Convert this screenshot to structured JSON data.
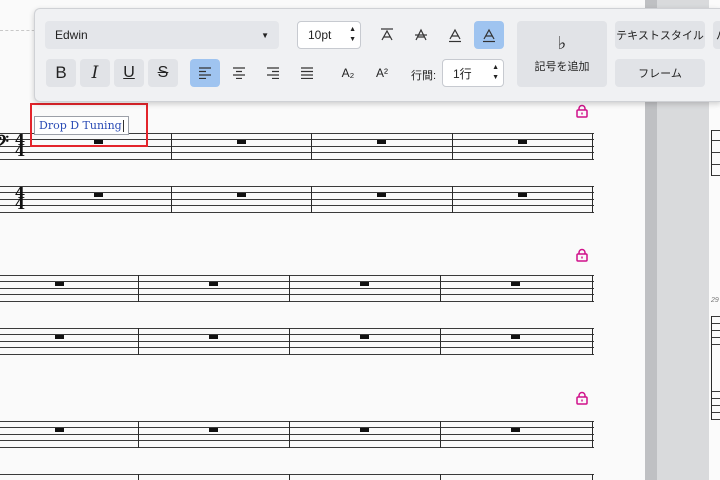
{
  "toolbar": {
    "font_name": "Edwin",
    "font_size": "10pt",
    "line_spacing_label": "行間:",
    "line_spacing_value": "1行",
    "add_symbol_label": "記号を追加",
    "add_symbol_glyph": "♭",
    "text_style_label": "テキストスタイル",
    "frame_label": "フレーム",
    "edge_label": "パ",
    "bold_label": "B",
    "italic_label": "I",
    "underline_label": "U",
    "strike_label": "S",
    "subscript_label": "A₂",
    "superscript_label": "A²",
    "active_buttons": [
      "align-left",
      "frame-text"
    ]
  },
  "score": {
    "staff_text": "Drop D Tuning",
    "time_signature_top": "4",
    "time_signature_bottom": "4",
    "clef": "𝄢",
    "lock_color": "#d0108a",
    "selection_color": "#e3242b",
    "text_color": "#2a4bb5",
    "next_page_number": "29"
  }
}
